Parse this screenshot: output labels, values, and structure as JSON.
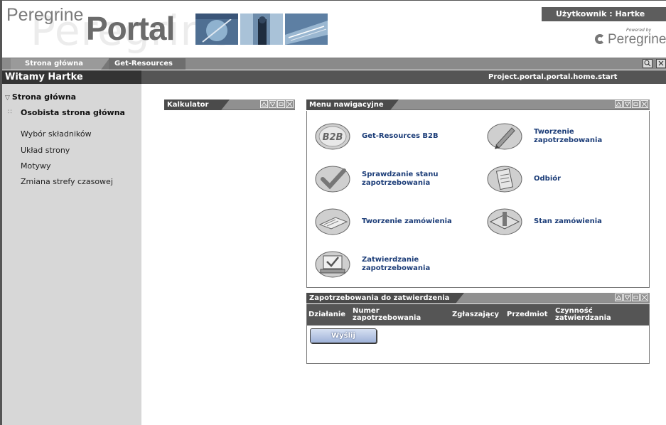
{
  "header": {
    "logo_small": "Peregrine",
    "logo_big": "Portal",
    "logo_watermark": "Peregrine",
    "user_label": "Użytkownik : Hartke",
    "powered_by": "Powered by",
    "brand": "Peregrine"
  },
  "tabs": [
    {
      "label": "Strona główna"
    },
    {
      "label": "Get-Resources"
    }
  ],
  "welcome": {
    "greeting": "Witamy Hartke",
    "path": "Project.portal.portal.home.start"
  },
  "sidebar": {
    "home": "Strona główna",
    "items": [
      {
        "label": "Osobista strona główna"
      },
      {
        "label": "Wybór składników"
      },
      {
        "label": "Układ strony"
      },
      {
        "label": "Motywy"
      },
      {
        "label": "Zmiana strefy czasowej"
      }
    ]
  },
  "kalkulator": {
    "title": "Kalkulator"
  },
  "menu": {
    "title": "Menu nawigacyjne",
    "items": [
      {
        "label": "Get-Resources B2B",
        "icon": "b2b-icon"
      },
      {
        "label": "Tworzenie zapotrzebowania",
        "icon": "pen-icon"
      },
      {
        "label": "Sprawdzanie stanu zapotrzebowania",
        "icon": "checkmark-icon"
      },
      {
        "label": "Odbiór",
        "icon": "clipboard-icon"
      },
      {
        "label": "Tworzenie zamówienia",
        "icon": "order-form-icon"
      },
      {
        "label": "Stan zamówienia",
        "icon": "order-status-icon"
      },
      {
        "label": "Zatwierdzanie zapotrzebowania",
        "icon": "approval-icon"
      }
    ]
  },
  "approvals": {
    "title": "Zapotrzebowania do zatwierdzenia",
    "columns": [
      "Działanie",
      "Numer zapotrzebowania",
      "Zgłaszający",
      "Przedmiot",
      "Czynność zatwierdzania"
    ],
    "send_label": "Wyślij"
  },
  "colors": {
    "sidebar_bg": "#d7d7d7",
    "header_dark": "#555555",
    "link_blue": "#1c3d78"
  }
}
